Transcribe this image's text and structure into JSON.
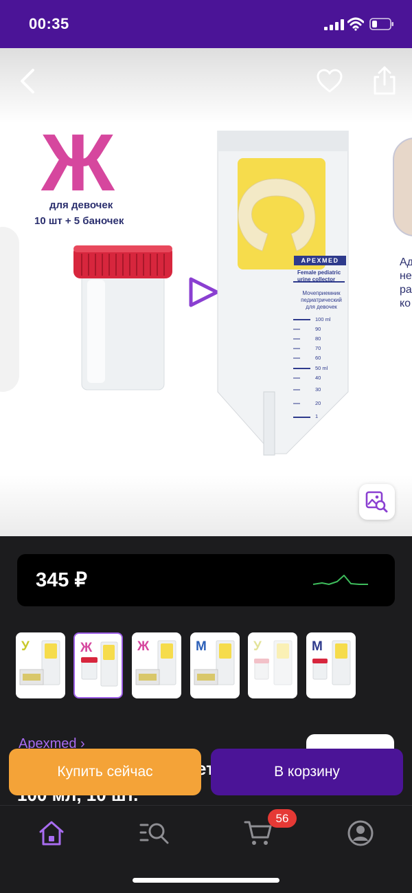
{
  "status_bar": {
    "time": "00:35"
  },
  "gallery": {
    "promo": {
      "letter": "Ж",
      "for_whom": "для девочек",
      "count": "10 шт + 5 баночек"
    },
    "bag": {
      "brand": "APEXMED",
      "en_line_1": "Female pediatric",
      "en_line_2": "urine collector",
      "ru_line_1": "Мочеприемник",
      "ru_line_2": "педиатрический",
      "ru_line_3": "для девочек",
      "scale": [
        "100 ml",
        "90",
        "80",
        "70",
        "60",
        "50 ml",
        "40",
        "30",
        "20",
        "1"
      ]
    },
    "next_slide_text": [
      "Ад",
      "не",
      "ра",
      "ко"
    ]
  },
  "price": {
    "value": "345 ₽",
    "trend_color": "#3ebd5c"
  },
  "thumbnails": [
    {
      "letter": "У",
      "color": "#c9c82a",
      "selected": false
    },
    {
      "letter": "Ж",
      "color": "#d6479e",
      "selected": true
    },
    {
      "letter": "Ж",
      "color": "#d6479e",
      "selected": false
    },
    {
      "letter": "М",
      "color": "#2b5fb8",
      "selected": false
    },
    {
      "letter": "У",
      "color": "#e3e39a",
      "selected": false
    },
    {
      "letter": "М",
      "color": "#2e3a8c",
      "selected": false
    }
  ],
  "product": {
    "brand_link": "Apexmed ›",
    "title_peek_1": "ет",
    "title_peek_2": "100 мл, 10 шт."
  },
  "actions": {
    "buy_now": "Купить сейчас",
    "add_to_cart": "В корзину"
  },
  "nav": {
    "cart_count": "56",
    "accent": "#a86cf0",
    "brand_purple": "#4b1497",
    "buy_orange": "#f4a338"
  }
}
